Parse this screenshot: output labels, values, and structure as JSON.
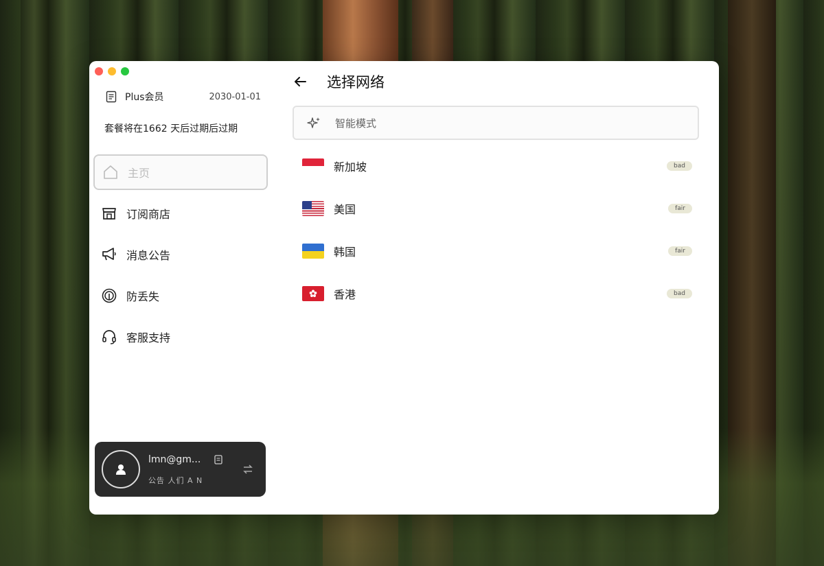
{
  "window": {
    "controls": [
      "close",
      "minimize",
      "maximize"
    ]
  },
  "sidebar": {
    "plan_name": "Plus会员",
    "plan_date": "2030-01-01",
    "expire_text": "套餐将在1662 天后过期后过期",
    "nav": [
      {
        "label": "主页",
        "icon": "home-icon",
        "active": true
      },
      {
        "label": "订阅商店",
        "icon": "store-icon",
        "active": false
      },
      {
        "label": "消息公告",
        "icon": "megaphone-icon",
        "active": false
      },
      {
        "label": "防丢失",
        "icon": "fingerprint-icon",
        "active": false
      },
      {
        "label": "客服支持",
        "icon": "headset-icon",
        "active": false
      }
    ],
    "user": {
      "email": "lmn@gm...",
      "sub_text": "公告 人们  A  N"
    }
  },
  "main": {
    "title": "选择网络",
    "smart_mode": "智能模式",
    "servers": [
      {
        "name": "新加坡",
        "flag": "singapore",
        "latency": "bad"
      },
      {
        "name": "美国",
        "flag": "usa",
        "latency": "fair"
      },
      {
        "name": "韩国",
        "flag": "ukraine",
        "latency": "fair"
      },
      {
        "name": "香港",
        "flag": "hong-kong",
        "latency": "bad"
      }
    ]
  },
  "colors": {
    "window_bg": "#ffffff",
    "user_card_bg": "#2b2b2b",
    "traffic_red": "#ff5f57",
    "traffic_yellow": "#febc2e",
    "traffic_green": "#28c840"
  }
}
